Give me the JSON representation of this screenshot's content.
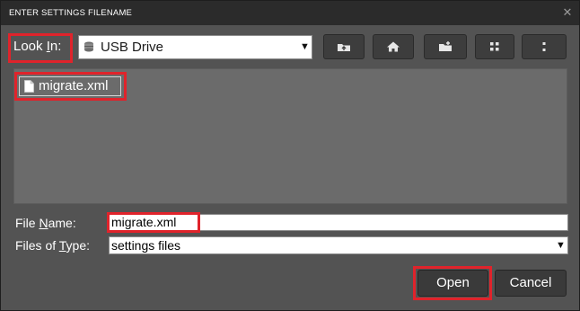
{
  "window": {
    "title": "ENTER SETTINGS FILENAME",
    "close_glyph": "✕"
  },
  "lookin": {
    "label_pre": "Look ",
    "label_mnemonic": "I",
    "label_post": "n:",
    "value": "USB Drive",
    "icon": "drive-icon",
    "arrow": "▼"
  },
  "toolbar": {
    "buttons": [
      "up-folder-icon",
      "home-icon",
      "new-folder-icon",
      "list-view-icon",
      "details-view-icon"
    ]
  },
  "files": [
    {
      "name": "migrate.xml",
      "icon": "file-icon"
    }
  ],
  "filename": {
    "label_pre": "File ",
    "label_mnemonic": "N",
    "label_post": "ame:",
    "value": "migrate.xml"
  },
  "filetype": {
    "label_pre": "Files of ",
    "label_mnemonic": "T",
    "label_post": "ype:",
    "value": "settings files",
    "arrow": "▼"
  },
  "buttons": {
    "open": "Open",
    "cancel": "Cancel"
  },
  "colors": {
    "highlight": "#e0232b",
    "panel": "#535353",
    "titlebar": "#2b2b2b",
    "file_pane": "#6b6b6b"
  }
}
